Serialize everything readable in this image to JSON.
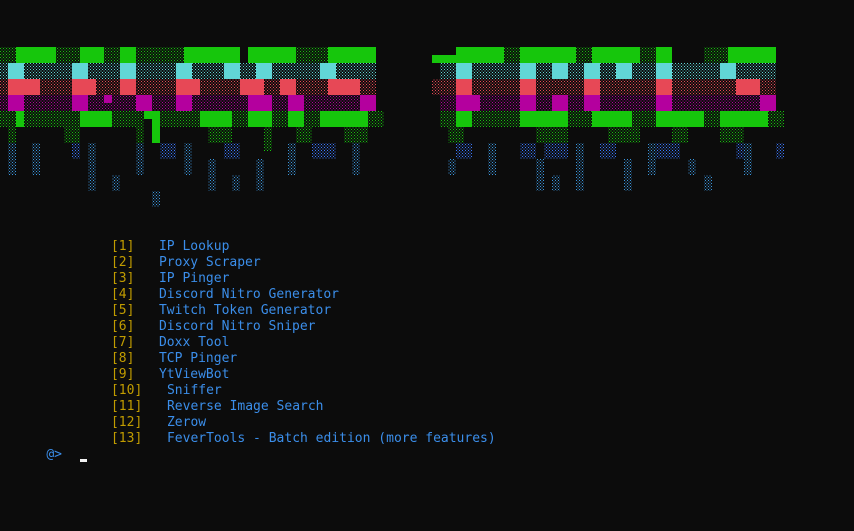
{
  "menu": [
    {
      "num": "[1]",
      "label": "IP Lookup"
    },
    {
      "num": "[2]",
      "label": "Proxy Scraper"
    },
    {
      "num": "[3]",
      "label": "IP Pinger"
    },
    {
      "num": "[4]",
      "label": "Discord Nitro Generator"
    },
    {
      "num": "[5]",
      "label": "Twitch Token Generator"
    },
    {
      "num": "[6]",
      "label": "Discord Nitro Sniper"
    },
    {
      "num": "[7]",
      "label": "Doxx Tool"
    },
    {
      "num": "[8]",
      "label": "TCP Pinger"
    },
    {
      "num": "[9]",
      "label": "YtViewBot"
    },
    {
      "num": "[10]",
      "label": "Sniffer"
    },
    {
      "num": "[11]",
      "label": "Reverse Image Search"
    },
    {
      "num": "[12]",
      "label": "Zerow"
    },
    {
      "num": "[13]",
      "label": "FeverTools - Batch edition (more features)"
    }
  ],
  "prompt": {
    "symbol": "@>"
  },
  "colors": {
    "background": "#0c0c0c",
    "number": "#c19c00",
    "label": "#3b8eea",
    "banner_green": "#16c60c",
    "banner_cyan": "#61d6d6",
    "banner_red": "#e74856",
    "banner_magenta": "#b4009e",
    "banner_blue": "#3b78ff"
  }
}
